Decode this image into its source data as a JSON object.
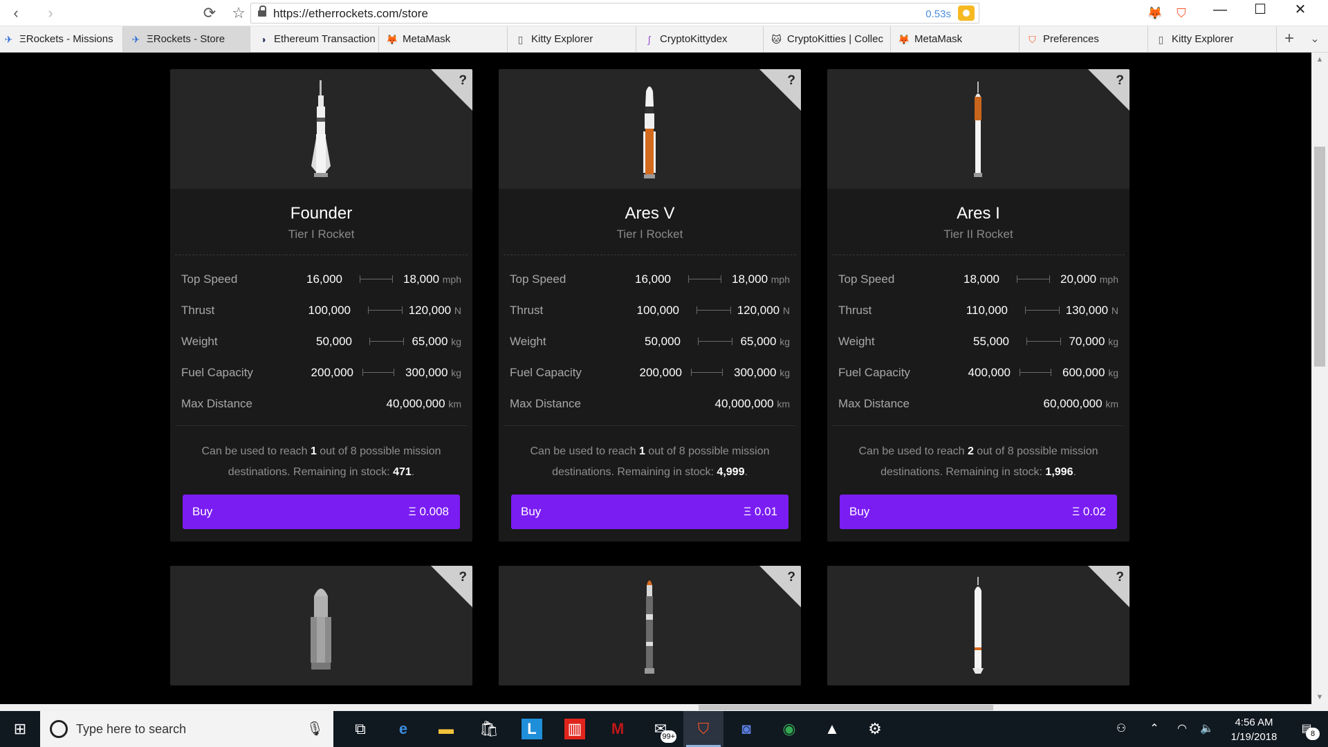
{
  "browser": {
    "url": "https://etherrockets.com/store",
    "load_time": "0.53s",
    "nav": {
      "back": "‹",
      "forward": "›",
      "reload": "⟳",
      "bookmark": "☆"
    },
    "window": {
      "minimize": "—",
      "maximize": "☐",
      "close": "✕"
    },
    "tabs": [
      {
        "label": "ΞRockets - Missions",
        "icon": "rocket-icon",
        "glyph": "✈"
      },
      {
        "label": "ΞRockets - Store",
        "icon": "rocket-icon",
        "glyph": "✈",
        "active": true
      },
      {
        "label": "Ethereum Transaction",
        "icon": "etherscan-icon",
        "glyph": "◑"
      },
      {
        "label": "MetaMask",
        "icon": "metamask-fox-icon",
        "glyph": "🦊"
      },
      {
        "label": "Kitty Explorer",
        "icon": "page-icon",
        "glyph": "▯"
      },
      {
        "label": "CryptoKittydex",
        "icon": "kittydex-icon",
        "glyph": "ʃ"
      },
      {
        "label": "CryptoKitties | Collec",
        "icon": "cryptokitties-icon",
        "glyph": "🐱"
      },
      {
        "label": "MetaMask",
        "icon": "metamask-fox-icon",
        "glyph": "🦊"
      },
      {
        "label": "Preferences",
        "icon": "brave-shield-icon",
        "glyph": "⛉"
      },
      {
        "label": "Kitty Explorer",
        "icon": "page-icon",
        "glyph": "▯"
      }
    ],
    "new_tab": "+",
    "tab_menu": "⌄"
  },
  "store": {
    "buy_label": "Buy",
    "question_mark": "?",
    "rockets": [
      {
        "name": "Founder",
        "tier": "Tier I Rocket",
        "stats": [
          {
            "label": "Top Speed",
            "min": "16,000",
            "max": "18,000",
            "unit": "mph"
          },
          {
            "label": "Thrust",
            "min": "100,000",
            "max": "120,000",
            "unit": "N"
          },
          {
            "label": "Weight",
            "min": "50,000",
            "max": "65,000",
            "unit": "kg"
          },
          {
            "label": "Fuel Capacity",
            "min": "200,000",
            "max": "300,000",
            "unit": "kg"
          },
          {
            "label": "Max Distance",
            "min": "",
            "max": "40,000,000",
            "unit": "km"
          }
        ],
        "desc_pre": "Can be used to reach ",
        "reach": "1",
        "desc_mid": " out of 8 possible mission destinations. Remaining in stock: ",
        "stock": "471",
        "desc_post": ".",
        "price": "Ξ 0.008"
      },
      {
        "name": "Ares V",
        "tier": "Tier I Rocket",
        "stats": [
          {
            "label": "Top Speed",
            "min": "16,000",
            "max": "18,000",
            "unit": "mph"
          },
          {
            "label": "Thrust",
            "min": "100,000",
            "max": "120,000",
            "unit": "N"
          },
          {
            "label": "Weight",
            "min": "50,000",
            "max": "65,000",
            "unit": "kg"
          },
          {
            "label": "Fuel Capacity",
            "min": "200,000",
            "max": "300,000",
            "unit": "kg"
          },
          {
            "label": "Max Distance",
            "min": "",
            "max": "40,000,000",
            "unit": "km"
          }
        ],
        "desc_pre": "Can be used to reach ",
        "reach": "1",
        "desc_mid": " out of 8 possible mission destinations. Remaining in stock: ",
        "stock": "4,999",
        "desc_post": ".",
        "price": "Ξ 0.01"
      },
      {
        "name": "Ares I",
        "tier": "Tier II Rocket",
        "stats": [
          {
            "label": "Top Speed",
            "min": "18,000",
            "max": "20,000",
            "unit": "mph"
          },
          {
            "label": "Thrust",
            "min": "110,000",
            "max": "130,000",
            "unit": "N"
          },
          {
            "label": "Weight",
            "min": "55,000",
            "max": "70,000",
            "unit": "kg"
          },
          {
            "label": "Fuel Capacity",
            "min": "400,000",
            "max": "600,000",
            "unit": "kg"
          },
          {
            "label": "Max Distance",
            "min": "",
            "max": "60,000,000",
            "unit": "km"
          }
        ],
        "desc_pre": "Can be used to reach ",
        "reach": "2",
        "desc_mid": " out of 8 possible mission destinations. Remaining in stock: ",
        "stock": "1,996",
        "desc_post": ".",
        "price": "Ξ 0.02"
      }
    ]
  },
  "taskbar": {
    "search_placeholder": "Type here to search",
    "mail_badge": "99+",
    "time": "4:56 AM",
    "date": "1/19/2018",
    "notification_count": "8",
    "apps": [
      {
        "name": "task-view-icon",
        "glyph": "⧉"
      },
      {
        "name": "edge-icon",
        "glyph": "e"
      },
      {
        "name": "file-explorer-icon",
        "glyph": "▬"
      },
      {
        "name": "store-icon",
        "glyph": "🛍"
      },
      {
        "name": "l-app-icon",
        "glyph": "L"
      },
      {
        "name": "red-app-icon",
        "glyph": "▥"
      },
      {
        "name": "mcafee-icon",
        "glyph": "M"
      },
      {
        "name": "mail-icon",
        "glyph": "✉"
      },
      {
        "name": "brave-icon",
        "glyph": "⛉"
      },
      {
        "name": "camera-app-icon",
        "glyph": "◙"
      },
      {
        "name": "chrome-icon",
        "glyph": "◉"
      },
      {
        "name": "photos-icon",
        "glyph": "▲"
      },
      {
        "name": "settings-icon",
        "glyph": "⚙"
      }
    ],
    "tray": {
      "people": "⚇",
      "chevron": "⌃",
      "wifi": "◠",
      "volume": "🔈",
      "notifications": "▤"
    }
  }
}
